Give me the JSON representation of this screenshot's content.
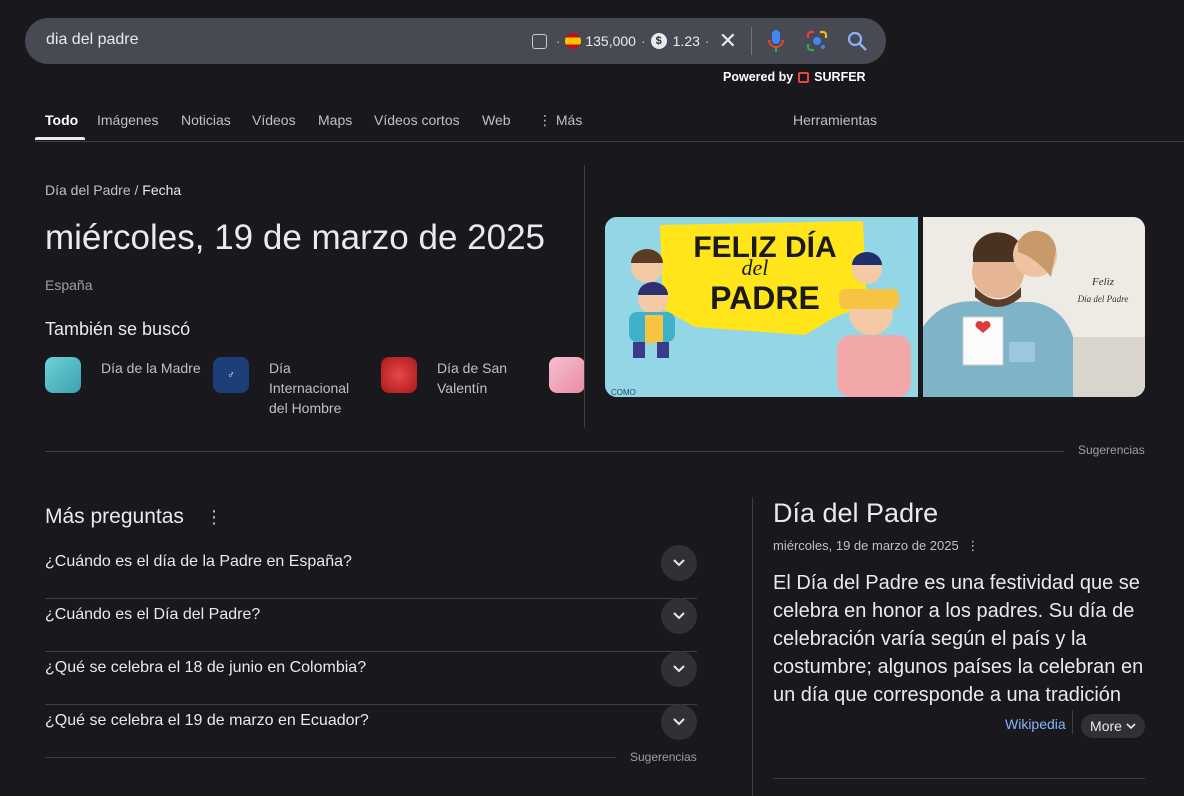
{
  "search": {
    "query": "dia del padre",
    "country_value": "135,000",
    "cpc_value": "1.23",
    "icons": [
      "checkbox-icon",
      "spain-flag-icon",
      "dollar-coin-icon",
      "close-icon",
      "mic-icon",
      "google-lens-icon",
      "search-icon"
    ]
  },
  "powered": {
    "prefix": "Powered by",
    "brand": "SURFER"
  },
  "tabs": [
    {
      "label": "Todo",
      "active": true
    },
    {
      "label": "Imágenes"
    },
    {
      "label": "Noticias"
    },
    {
      "label": "Vídeos"
    },
    {
      "label": "Maps"
    },
    {
      "label": "Vídeos cortos"
    },
    {
      "label": "Web"
    },
    {
      "label": "Más"
    },
    {
      "label": "Herramientas"
    }
  ],
  "result": {
    "breadcrumb": {
      "root": "Día del Padre",
      "separator": "/",
      "leaf": "Fecha"
    },
    "date": "miércoles, 19 de marzo de 2025",
    "country": "España",
    "also_searched_title": "También se buscó",
    "related": [
      {
        "label": "Día de la Madre"
      },
      {
        "label": "Día Internacional del Hombre"
      },
      {
        "label": "Día de San Valentín"
      }
    ]
  },
  "images": {
    "img1_text": [
      "FELIZ DÍA",
      "del",
      "PADRE"
    ],
    "img1_corner": "COMO",
    "img2_text": [
      "Feliz",
      "Día del Padre"
    ],
    "suggestions_label": "Sugerencias"
  },
  "more_questions": {
    "title": "Más preguntas",
    "items": [
      "¿Cuándo es el día de la Padre en España?",
      "¿Cuándo es el Día del Padre?",
      "¿Qué se celebra el 18 de junio en Colombia?",
      "¿Qué se celebra el 19 de marzo en Ecuador?"
    ],
    "suggestions_label": "Sugerencias"
  },
  "knowledge_panel": {
    "title": "Día del Padre",
    "subtitle": "miércoles, 19 de marzo de 2025",
    "description": "El Día del Padre es una festividad que se celebra en honor a los padres. Su día de celebración varía según el país y la costumbre; algunos países la celebran en un día que corresponde a una tradición",
    "source": "Wikipedia",
    "more_label": "More"
  },
  "colors": {
    "background": "#18181d",
    "accent_link": "#8ab4f8",
    "surfer_red": "#e8453c"
  }
}
